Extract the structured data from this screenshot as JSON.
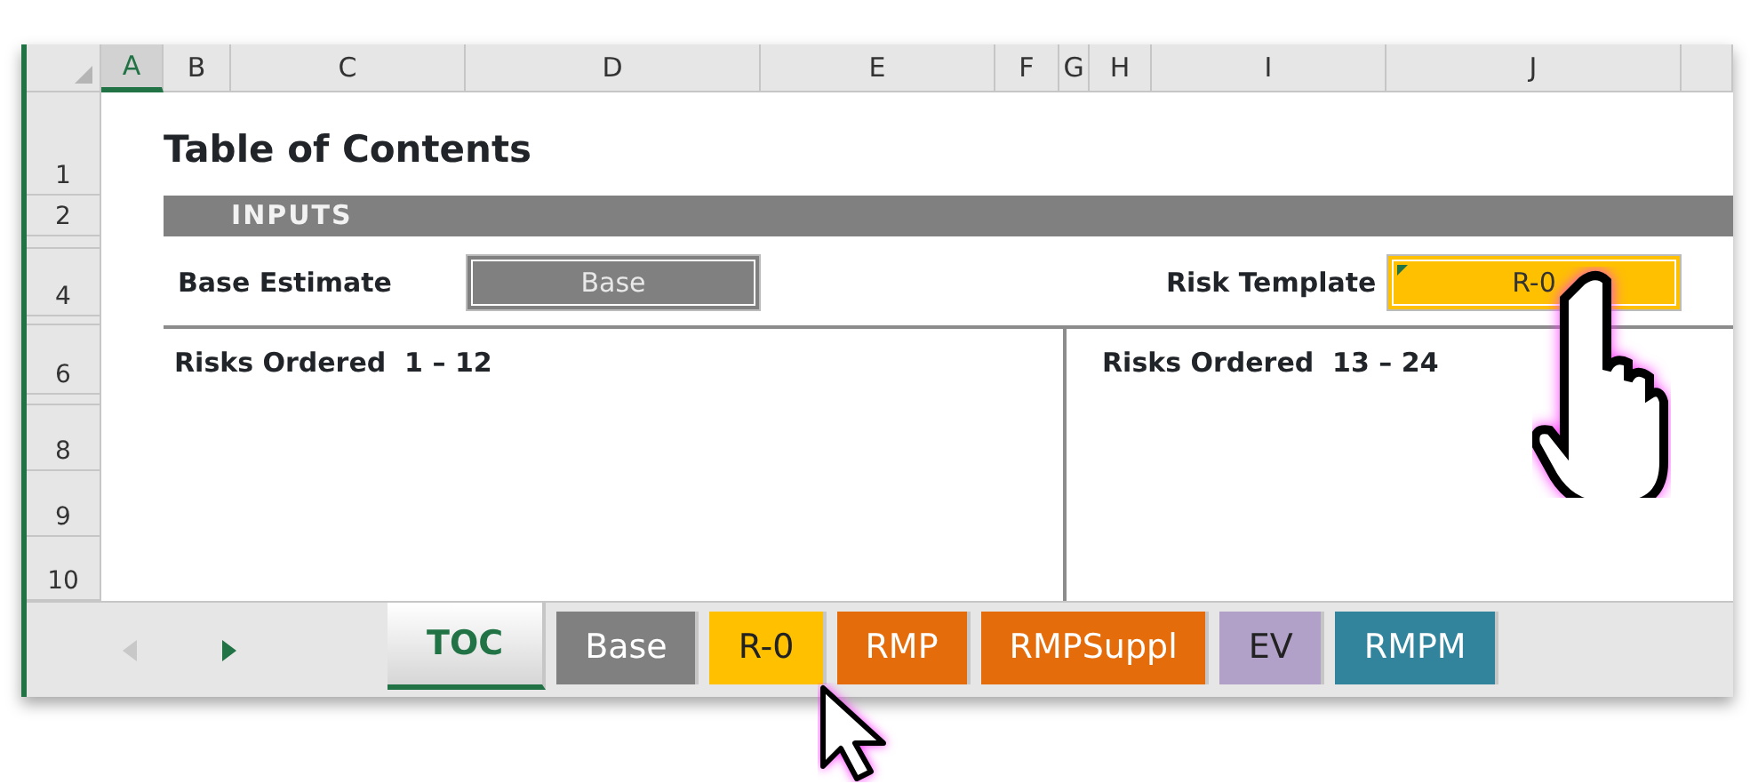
{
  "column_headers": [
    {
      "label": "A",
      "selected": true
    },
    {
      "label": "B",
      "selected": false
    },
    {
      "label": "C",
      "selected": false
    },
    {
      "label": "D",
      "selected": false
    },
    {
      "label": "E",
      "selected": false
    },
    {
      "label": "F",
      "selected": false
    },
    {
      "label": "G",
      "selected": false
    },
    {
      "label": "H",
      "selected": false
    },
    {
      "label": "I",
      "selected": false
    },
    {
      "label": "J",
      "selected": false
    }
  ],
  "row_headers": [
    "1",
    "2",
    "4",
    "6",
    "8",
    "9",
    "10"
  ],
  "title": "Table of Contents",
  "section_header": "INPUTS",
  "inputs": [
    {
      "label": "Base Estimate",
      "value": "Base",
      "color": "#808080",
      "flagged": false
    },
    {
      "label": "Risk Template",
      "value": "R-0",
      "color": "#ffc000",
      "flagged": true
    }
  ],
  "panels": [
    "Risks Ordered  1 – 12",
    "Risks Ordered  13 – 24"
  ],
  "sheet_nav": [
    {
      "kind": "prev",
      "disabled": true
    },
    {
      "kind": "next",
      "disabled": false
    }
  ],
  "sheet_tabs": [
    {
      "label": "TOC",
      "selected": true,
      "color": "#ffffff"
    },
    {
      "label": "Base",
      "selected": false,
      "color": "#808080"
    },
    {
      "label": "R-0",
      "selected": false,
      "color": "#ffc000"
    },
    {
      "label": "RMP",
      "selected": false,
      "color": "#e46c0a"
    },
    {
      "label": "RMPSuppl",
      "selected": false,
      "color": "#e46c0a"
    },
    {
      "label": "EV",
      "selected": false,
      "color": "#b1a0c7"
    },
    {
      "label": "RMPM",
      "selected": false,
      "color": "#31849b"
    }
  ]
}
